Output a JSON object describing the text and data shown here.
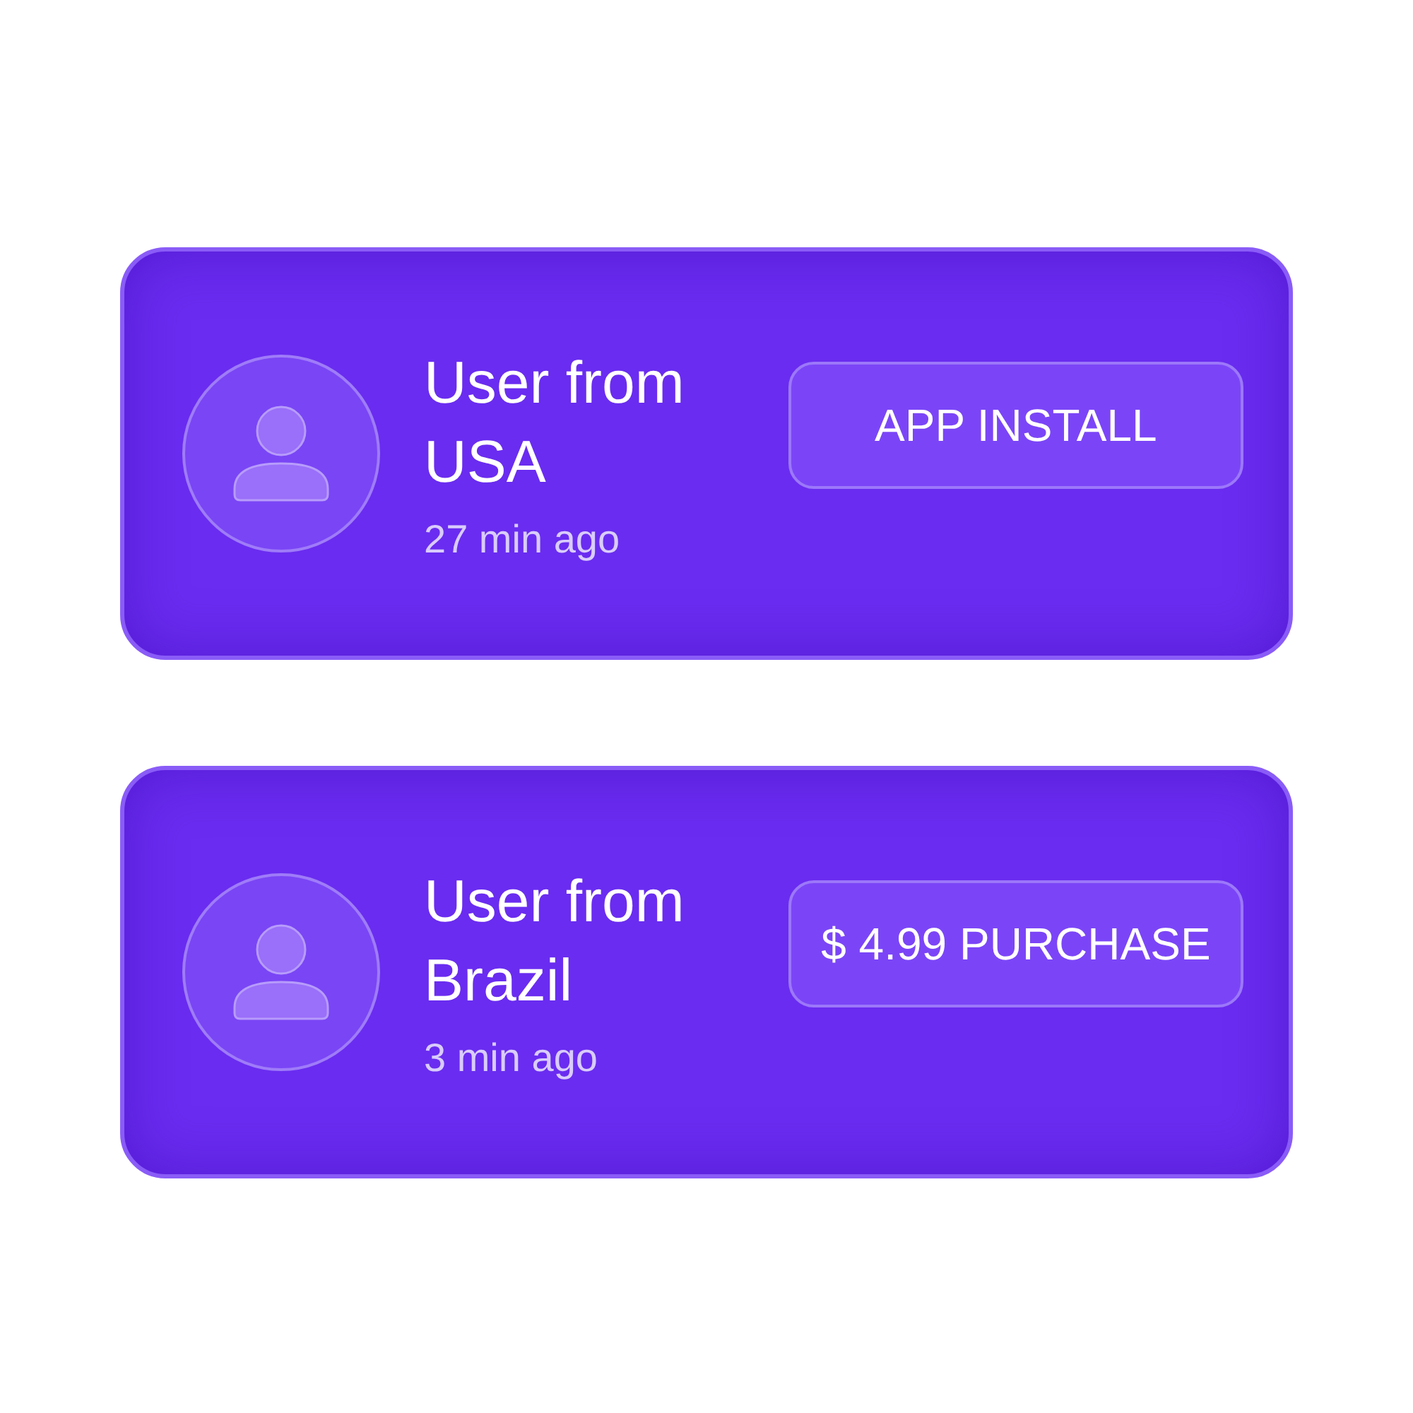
{
  "notifications": [
    {
      "user": "User from USA",
      "time": "27 min ago",
      "action": "APP INSTALL"
    },
    {
      "user": "User from Brazil",
      "time": "3 min ago",
      "action": "$ 4.99 PURCHASE"
    }
  ]
}
